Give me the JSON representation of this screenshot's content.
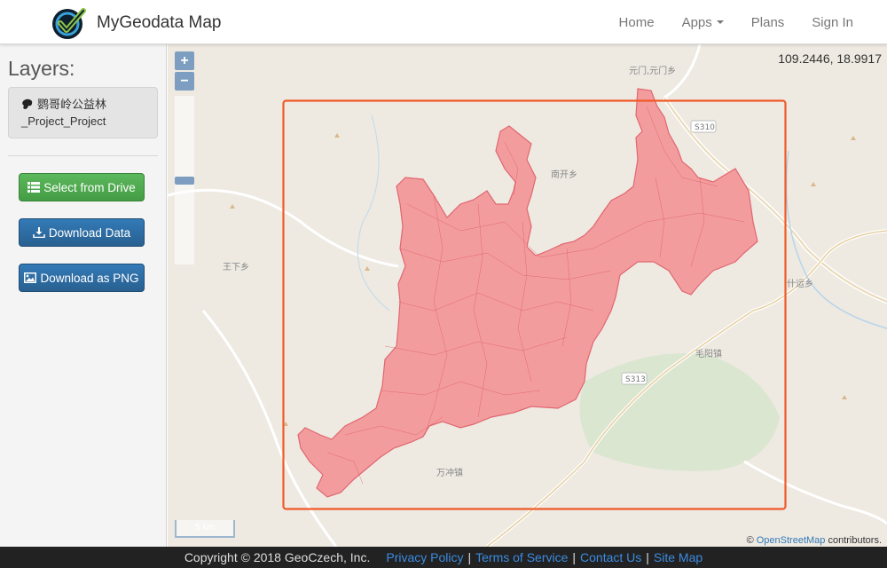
{
  "app": {
    "brand": "MyGeodata Map"
  },
  "nav": {
    "home": "Home",
    "apps": "Apps",
    "plans": "Plans",
    "signin": "Sign In"
  },
  "sidebar": {
    "title": "Layers:",
    "layer_name": "鹦哥岭公益林_Project_Project",
    "buttons": {
      "select": "Select from Drive",
      "download": "Download Data",
      "png": "Download as PNG"
    }
  },
  "map": {
    "coords": "109.2446, 18.9917",
    "scale": "5 km",
    "zoom_in": "+",
    "zoom_out": "−",
    "attribution_prefix": "©",
    "attribution_link": "OpenStreetMap",
    "attribution_suffix": "contributors.",
    "labels": {
      "yuanmen": "元门,元门乡",
      "nankai": "南开乡",
      "wangxia": "王下乡",
      "maoyang": "毛阳镇",
      "wanchong": "万冲镇",
      "shiyun": "什运乡",
      "s310": "S310",
      "s313": "S313"
    },
    "colors": {
      "polygon_fill": "#f4989b",
      "polygon_stroke": "#e0606a",
      "bbox": "#f05a28"
    }
  },
  "footer": {
    "copyright": "Copyright © 2018 GeoCzech, Inc.",
    "privacy": "Privacy Policy",
    "terms": "Terms of Service",
    "contact": "Contact Us",
    "sitemap": "Site Map"
  }
}
